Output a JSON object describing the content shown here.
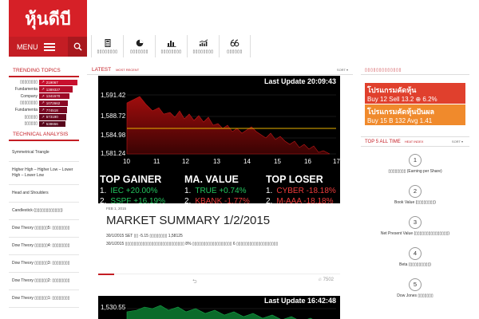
{
  "site": {
    "logo_text": "หุ้นดีบี"
  },
  "header": {
    "menu_label": "MENU",
    "search_icon": "search-icon"
  },
  "nav": [
    {
      "icon": "calculator-icon",
      "label": "▯▯▯▯▯▯▯▯"
    },
    {
      "icon": "pie-chart-icon",
      "label": "▯▯▯▯▯▯▯"
    },
    {
      "icon": "bar-chart-icon",
      "label": "▯▯▯▯▯▯▯▯"
    },
    {
      "icon": "line-chart-icon",
      "label": "▯▯▯▯▯▯▯▯"
    },
    {
      "icon": "quote-icon",
      "label": "▯▯▯▯▯▯"
    }
  ],
  "trending": {
    "title": "TRENDING TOPICS",
    "items": [
      {
        "name": "▯▯▯▯▯▯▯▯",
        "count": "219067",
        "fill": 1.0,
        "color": "#c8102e"
      },
      {
        "name": "Fundamenta",
        "count": "1389327",
        "fill": 0.87,
        "color": "#b10d2a"
      },
      {
        "name": "Company",
        "count": "1341570",
        "fill": 0.8,
        "color": "#9d0b27"
      },
      {
        "name": "▯▯▯▯▯▯▯▯",
        "count": "1072662",
        "fill": 0.76,
        "color": "#8a0924"
      },
      {
        "name": "Fundamenta",
        "count": "774518",
        "fill": 0.73,
        "color": "#780821"
      },
      {
        "name": "▯▯▯▯▯▯",
        "count": "573190",
        "fill": 0.7,
        "color": "#67071e"
      },
      {
        "name": "▯▯▯▯▯▯",
        "count": "538656",
        "fill": 0.68,
        "color": "#57061b"
      }
    ]
  },
  "technical": {
    "title": "TECHNICAL ANALYSIS",
    "items": [
      "Symmetrical Triangle",
      "Higher High – Higher Low – Lower High – Lower Low",
      "Head and Shoulders",
      "Candlestick (▯▯▯▯▯▯▯▯▯▯▯▯)",
      "Dow Theory ▯▯▯▯▯▯5: ▯▯▯▯▯▯▯▯",
      "Dow Theory ▯▯▯▯▯▯4: ▯▯▯▯▯▯▯▯",
      "Dow Theory ▯▯▯▯▯▯3: ▯▯▯▯▯▯▯▯",
      "Dow Theory ▯▯▯▯▯▯2: ▯▯▯▯▯▯▯▯",
      "Dow Theory ▯▯▯▯▯▯1: ▯▯▯▯▯▯▯▯"
    ]
  },
  "main": {
    "tab_latest": "LATEST",
    "tab_recent": "MOST RECENT",
    "sort_label": "SORT ▾",
    "chart_update": "Last Update 20:09:43",
    "y_ticks": [
      "1,591.42",
      "1,588.72",
      "1,584.98",
      "1,581.24"
    ],
    "x_ticks": [
      "10",
      "11",
      "12",
      "13",
      "14",
      "15",
      "16",
      "17"
    ],
    "gainer_title": "TOP GAINER",
    "value_title": "MA. VALUE",
    "loser_title": "TOP LOSER",
    "gainers": [
      {
        "n": "1.",
        "t": "IEC +20.00%"
      },
      {
        "n": "2.",
        "t": "SSPF +16.19%"
      }
    ],
    "values": [
      {
        "n": "1.",
        "t": "TRUE +0.74%"
      },
      {
        "n": "2.",
        "t": "KBANK -1.77%"
      }
    ],
    "losers": [
      {
        "n": "1.",
        "t": "CYBER -18.18%"
      },
      {
        "n": "2.",
        "t": "M-AAA -18.18%"
      }
    ],
    "article_date": "FEB 1, 2015",
    "article_title": "MARKET SUMMARY 1/2/2015",
    "article_line1": "30/1/2015 SET ▯▯ -5.15 ▯▯▯▯▯▯▯▯ 1,58125",
    "article_line2": "30/1/2015 ▯▯▯▯▯▯▯▯▯▯▯▯▯▯▯▯▯▯▯▯▯▯▯▯▯▯▯ 8% ▯▯▯▯▯▯▯▯▯▯▯▯▯▯▯▯▯▯ 6 ▯▯▯▯▯▯▯▯▯▯▯▯▯▯▯▯▯▯▯",
    "views": "7502",
    "chart2_update": "Last Update 16:42:48",
    "chart2_ytick": "1,530.55"
  },
  "right": {
    "title": "▯▯▯▯▯▯▯▯▯▯▯▯▯",
    "promo1_a": "โปรแกรมคัดหุ้น",
    "promo1_b": "Buy 12 Sell 13.2 ⊕ 6.2%",
    "promo2_a": "โปรแกรมคัดหุ้นปันผล",
    "promo2_b": "Buy 15 B 132 Avg 1.41",
    "top5_title": "TOP 5 ALL TIME",
    "top5_heat": "HEAT INDEX",
    "top5_sort": "SORT ▾",
    "top5": [
      {
        "rank": "1",
        "label": "▯▯▯▯▯▯▯▯ (Earning per Share)"
      },
      {
        "rank": "2",
        "label": "Book Value (▯▯▯▯▯▯▯▯)"
      },
      {
        "rank": "3",
        "label": "Net Present Value (▯▯▯▯▯▯▯▯▯▯▯▯▯▯▯)"
      },
      {
        "rank": "4",
        "label": "Beta (▯▯▯▯▯▯▯▯▯)"
      },
      {
        "rank": "5",
        "label": "Dow Jones ▯▯▯▯▯▯▯"
      }
    ]
  },
  "colors": {
    "brand": "#d62027",
    "dark_brand": "#c41d24",
    "green": "#22c55e",
    "red": "#ef3b3b",
    "chart_fill": "#8b0a0a"
  }
}
